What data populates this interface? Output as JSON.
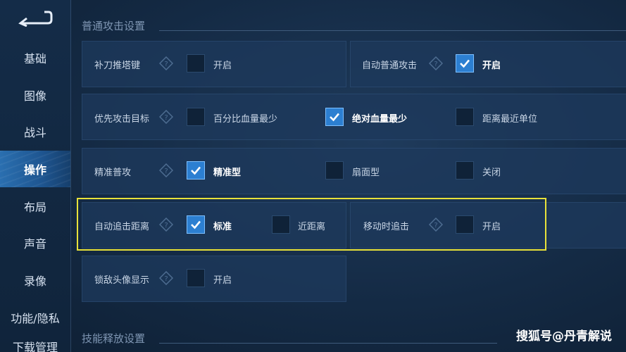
{
  "sidebar": {
    "items": [
      {
        "label": "基础"
      },
      {
        "label": "图像"
      },
      {
        "label": "战斗"
      },
      {
        "label": "操作"
      },
      {
        "label": "布局"
      },
      {
        "label": "声音"
      },
      {
        "label": "录像"
      },
      {
        "label": "功能/隐私"
      },
      {
        "label": "下载管理"
      }
    ],
    "active_index": 3
  },
  "sections": {
    "normal_attack": "普通攻击设置",
    "skill_release": "技能释放设置"
  },
  "settings": {
    "last_hit_key": {
      "label": "补刀推塔键",
      "option": "开启",
      "checked": false
    },
    "auto_attack": {
      "label": "自动普通攻击",
      "option": "开启",
      "checked": true
    },
    "priority_target": {
      "label": "优先攻击目标",
      "options": [
        {
          "label": "百分比血量最少",
          "checked": false
        },
        {
          "label": "绝对血量最少",
          "checked": true
        },
        {
          "label": "距离最近单位",
          "checked": false
        }
      ]
    },
    "precise_attack": {
      "label": "精准普攻",
      "options": [
        {
          "label": "精准型",
          "checked": true
        },
        {
          "label": "扇面型",
          "checked": false
        },
        {
          "label": "关闭",
          "checked": false
        }
      ]
    },
    "auto_chase": {
      "label": "自动追击距离",
      "options": [
        {
          "label": "标准",
          "checked": true
        },
        {
          "label": "近距离",
          "checked": false
        }
      ]
    },
    "move_chase": {
      "label": "移动时追击",
      "option": "开启",
      "checked": false
    },
    "lock_avatar": {
      "label": "锁敌头像显示",
      "option": "开启",
      "checked": false
    }
  },
  "watermark": "搜狐号@丹青解说",
  "colors": {
    "highlight": "#e8e23a",
    "checkbox_on": "#2c7fd1",
    "active_nav": "#2a6fb0"
  }
}
